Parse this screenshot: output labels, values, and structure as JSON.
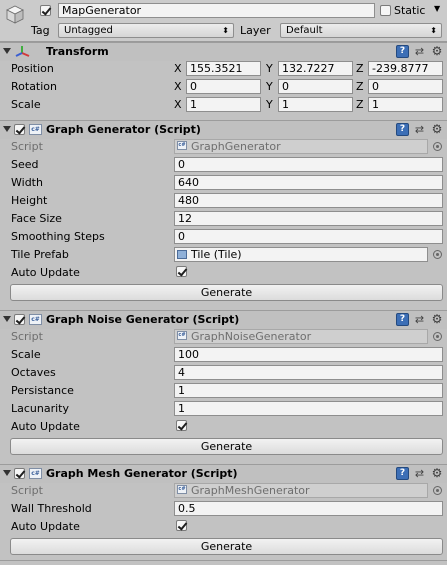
{
  "gameobject": {
    "name": "MapGenerator",
    "active": true,
    "static_label": "Static",
    "static_checked": false,
    "tag_label": "Tag",
    "tag_value": "Untagged",
    "layer_label": "Layer",
    "layer_value": "Default"
  },
  "transform": {
    "title": "Transform",
    "rows": [
      {
        "label": "Position",
        "x": "155.3521",
        "y": "132.7227",
        "z": "-239.8777"
      },
      {
        "label": "Rotation",
        "x": "0",
        "y": "0",
        "z": "0"
      },
      {
        "label": "Scale",
        "x": "1",
        "y": "1",
        "z": "1"
      }
    ],
    "axis": {
      "x": "X",
      "y": "Y",
      "z": "Z"
    }
  },
  "graph_generator": {
    "title": "Graph Generator (Script)",
    "script_label": "Script",
    "script_value": "GraphGenerator",
    "fields": [
      {
        "label": "Seed",
        "value": "0"
      },
      {
        "label": "Width",
        "value": "640"
      },
      {
        "label": "Height",
        "value": "480"
      },
      {
        "label": "Face Size",
        "value": "12"
      },
      {
        "label": "Smoothing Steps",
        "value": "0"
      }
    ],
    "tile_prefab_label": "Tile Prefab",
    "tile_prefab_value": "Tile (Tile)",
    "auto_update_label": "Auto Update",
    "auto_update": true,
    "button": "Generate"
  },
  "graph_noise_generator": {
    "title": "Graph Noise Generator (Script)",
    "script_label": "Script",
    "script_value": "GraphNoiseGenerator",
    "fields": [
      {
        "label": "Scale",
        "value": "100"
      },
      {
        "label": "Octaves",
        "value": "4"
      },
      {
        "label": "Persistance",
        "value": "1"
      },
      {
        "label": "Lacunarity",
        "value": "1"
      }
    ],
    "auto_update_label": "Auto Update",
    "auto_update": true,
    "button": "Generate"
  },
  "graph_mesh_generator": {
    "title": "Graph Mesh Generator (Script)",
    "script_label": "Script",
    "script_value": "GraphMeshGenerator",
    "fields": [
      {
        "label": "Wall Threshold",
        "value": "0.5"
      }
    ],
    "auto_update_label": "Auto Update",
    "auto_update": true,
    "button": "Generate"
  },
  "icons": {
    "gameobject": "cube-icon",
    "transform": "transform-axes-icon",
    "script": "script-icon",
    "help": "help-icon",
    "preset": "preset-icon",
    "settings": "gear-icon"
  },
  "colors": {
    "panel_bg": "#c2c2c2",
    "field_bg": "#f3f3f3",
    "help_blue": "#3d6fb6"
  }
}
